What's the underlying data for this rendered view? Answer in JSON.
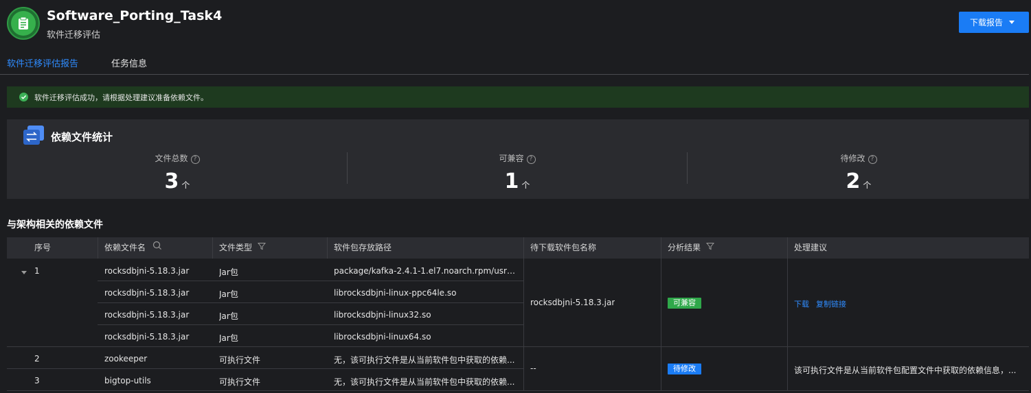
{
  "header": {
    "title": "Software_Porting_Task4",
    "subtitle": "软件迁移评估",
    "download_label": "下载报告",
    "icon": "clipboard-icon",
    "icon_color": "#36b04c"
  },
  "tabs": [
    {
      "label": "软件迁移评估报告",
      "active": true
    },
    {
      "label": "任务信息",
      "active": false
    }
  ],
  "alert": {
    "text": "软件迁移评估成功，请根据处理建议准备依赖文件。",
    "icon": "check-circle-icon",
    "color": "#3db057"
  },
  "stats": {
    "title": "依赖文件统计",
    "icon": "transfer-icon",
    "items": [
      {
        "label": "文件总数",
        "value": "3",
        "unit": "个"
      },
      {
        "label": "可兼容",
        "value": "1",
        "unit": "个"
      },
      {
        "label": "待修改",
        "value": "2",
        "unit": "个"
      }
    ]
  },
  "section_title": "与架构相关的依赖文件",
  "table": {
    "columns": [
      "序号",
      "依赖文件名",
      "文件类型",
      "软件包存放路径",
      "待下载软件包名称",
      "分析结果",
      "处理建议"
    ],
    "rows": [
      {
        "index": "1",
        "name": "rocksdbjni-5.18.3.jar",
        "type": "Jar包",
        "path": "package/kafka-2.4.1-1.el7.noarch.rpm/usr/lib/..."
      },
      {
        "index": "",
        "name": "rocksdbjni-5.18.3.jar",
        "type": "Jar包",
        "path": "librocksdbjni-linux-ppc64le.so"
      },
      {
        "index": "",
        "name": "rocksdbjni-5.18.3.jar",
        "type": "Jar包",
        "path": "librocksdbjni-linux32.so"
      },
      {
        "index": "",
        "name": "rocksdbjni-5.18.3.jar",
        "type": "Jar包",
        "path": "librocksdbjni-linux64.so"
      },
      {
        "index": "2",
        "name": "zookeeper",
        "type": "可执行文件",
        "path": "无，该可执行文件是从当前软件包中获取的依赖..."
      },
      {
        "index": "3",
        "name": "bigtop-utils",
        "type": "可执行文件",
        "path": "无，该可执行文件是从当前软件包中获取的依赖..."
      }
    ],
    "group1": {
      "package": "rocksdbjni-5.18.3.jar",
      "result": "可兼容",
      "result_color": "#2fa84a",
      "download_link": "下载",
      "copy_link": "复制链接"
    },
    "group2": {
      "package": "--",
      "result": "待修改",
      "result_color": "#1a7cf5",
      "advice": "该可执行文件是从当前软件包配置文件中获取的依赖信息，..."
    }
  }
}
